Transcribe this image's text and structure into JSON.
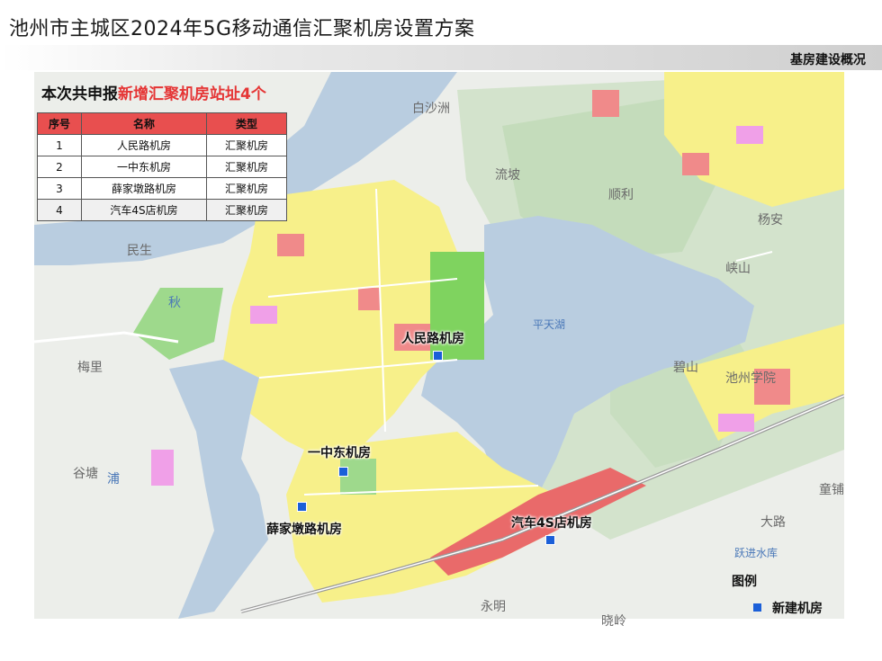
{
  "title": "池州市主城区2024年5G移动通信汇聚机房设置方案",
  "section_label": "基房建设概况",
  "headline": {
    "prefix": "本次共申报",
    "highlight": "新增汇聚机房站址4个"
  },
  "table": {
    "headers": [
      "序号",
      "名称",
      "类型"
    ],
    "rows": [
      [
        "1",
        "人民路机房",
        "汇聚机房"
      ],
      [
        "2",
        "一中东机房",
        "汇聚机房"
      ],
      [
        "3",
        "薛家墩路机房",
        "汇聚机房"
      ],
      [
        "4",
        "汽车4S店机房",
        "汇聚机房"
      ]
    ]
  },
  "sites": [
    {
      "name": "人民路机房"
    },
    {
      "name": "一中东机房"
    },
    {
      "name": "薛家墩路机房"
    },
    {
      "name": "汽车4S店机房"
    }
  ],
  "places": [
    "白沙洲",
    "流坡",
    "顺利",
    "杨安",
    "民生",
    "梅里",
    "谷塘",
    "童铺",
    "大路",
    "永明",
    "晓岭",
    "碧山",
    "池州学院",
    "峡山",
    "秋",
    "浦",
    "跃进水库",
    "平天湖"
  ],
  "legend": {
    "title": "图例",
    "item": "新建机房",
    "color": "#1b5fd8"
  },
  "colors": {
    "water": "#b9cde0",
    "residential": "#f7f08a",
    "commercial": "#f08a8a",
    "green": "#9ed98c",
    "magenta": "#f0a0e8",
    "marker": "#1b5fd8"
  }
}
